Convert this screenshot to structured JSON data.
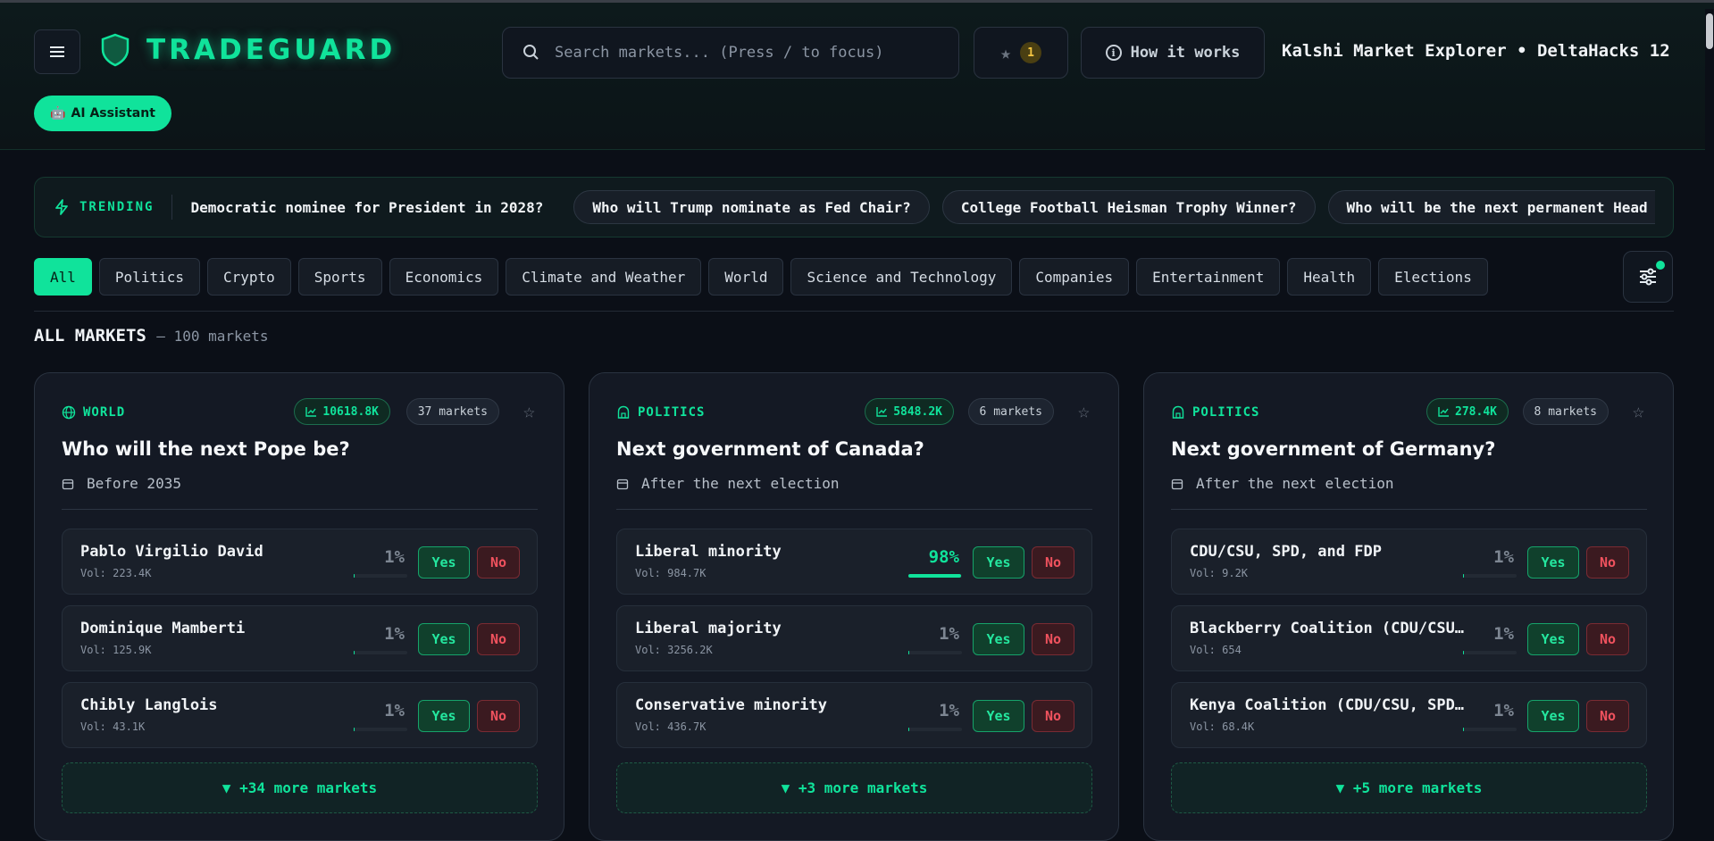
{
  "header": {
    "logo_text": "TRADEGUARD",
    "search_placeholder": "Search markets... (Press / to focus)",
    "favorites_count": "1",
    "how_it_works": "How it works",
    "title": "Kalshi Market Explorer • DeltaHacks 12",
    "ai_assistant": "AI Assistant"
  },
  "trending": {
    "label": "TRENDING",
    "items": [
      "Democratic nominee for President in 2028?",
      "Who will Trump nominate as Fed Chair?",
      "College Football Heisman Trophy Winner?",
      "Who will be the next permanent Head Coach o"
    ]
  },
  "categories": [
    "All",
    "Politics",
    "Crypto",
    "Sports",
    "Economics",
    "Climate and Weather",
    "World",
    "Science and Technology",
    "Companies",
    "Entertainment",
    "Health",
    "Elections"
  ],
  "section": {
    "title": "ALL MARKETS",
    "subtitle": "— 100 markets"
  },
  "cards": [
    {
      "category": "WORLD",
      "volume": "10618.8K",
      "markets": "37 markets",
      "title": "Who will the next Pope be?",
      "date": "Before 2035",
      "options": [
        {
          "name": "Pablo Virgilio David",
          "vol": "Vol: 223.4K",
          "pct": "1%",
          "prob": 0.01
        },
        {
          "name": "Dominique Mamberti",
          "vol": "Vol: 125.9K",
          "pct": "1%",
          "prob": 0.01
        },
        {
          "name": "Chibly Langlois",
          "vol": "Vol: 43.1K",
          "pct": "1%",
          "prob": 0.01
        }
      ],
      "more": "▼ +34 more markets"
    },
    {
      "category": "POLITICS",
      "volume": "5848.2K",
      "markets": "6 markets",
      "title": "Next government of Canada?",
      "date": "After the next election",
      "options": [
        {
          "name": "Liberal minority",
          "vol": "Vol: 984.7K",
          "pct": "98%",
          "prob": 0.98
        },
        {
          "name": "Liberal majority",
          "vol": "Vol: 3256.2K",
          "pct": "1%",
          "prob": 0.01
        },
        {
          "name": "Conservative minority",
          "vol": "Vol: 436.7K",
          "pct": "1%",
          "prob": 0.01
        }
      ],
      "more": "▼ +3 more markets"
    },
    {
      "category": "POLITICS",
      "volume": "278.4K",
      "markets": "8 markets",
      "title": "Next government of Germany?",
      "date": "After the next election",
      "options": [
        {
          "name": "CDU/CSU, SPD, and FDP",
          "vol": "Vol: 9.2K",
          "pct": "1%",
          "prob": 0.01
        },
        {
          "name": "Blackberry Coalition (CDU/CSU…",
          "vol": "Vol: 654",
          "pct": "1%",
          "prob": 0.01
        },
        {
          "name": "Kenya Coalition (CDU/CSU, SPD…",
          "vol": "Vol: 68.4K",
          "pct": "1%",
          "prob": 0.01
        }
      ],
      "more": "▼ +5 more markets"
    }
  ],
  "buttons": {
    "yes": "Yes",
    "no": "No"
  },
  "colors": {
    "accent": "#10e39b",
    "background": "#0b0f17",
    "no": "#f0525e"
  }
}
